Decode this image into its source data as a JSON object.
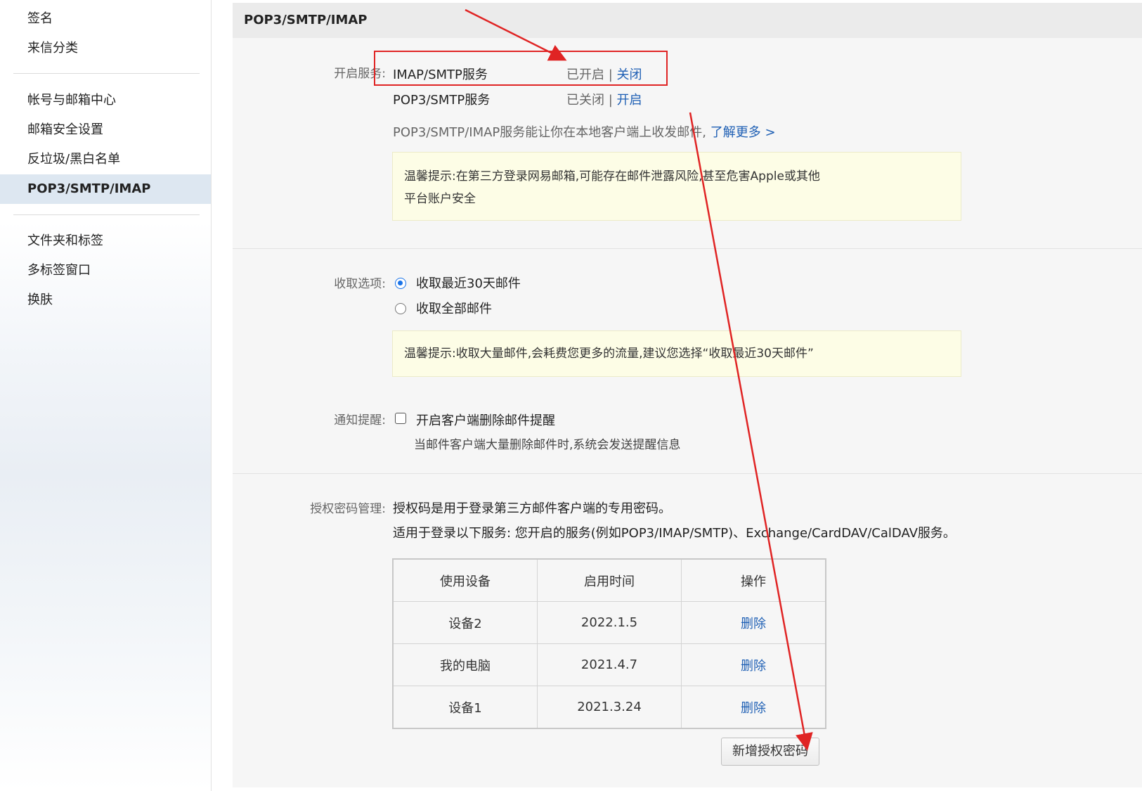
{
  "sidebar": {
    "items": [
      {
        "label": "签名"
      },
      {
        "label": "来信分类"
      },
      {
        "label": "帐号与邮箱中心"
      },
      {
        "label": "邮箱安全设置"
      },
      {
        "label": "反垃圾/黑白名单"
      },
      {
        "label": "POP3/SMTP/IMAP",
        "active": true
      },
      {
        "label": "文件夹和标签"
      },
      {
        "label": "多标签窗口"
      },
      {
        "label": "换肤"
      }
    ]
  },
  "panel": {
    "title": "POP3/SMTP/IMAP",
    "services": {
      "label": "开启服务:",
      "rows": [
        {
          "name": "IMAP/SMTP服务",
          "status": "已开启",
          "sep": "|",
          "action": "关闭"
        },
        {
          "name": "POP3/SMTP服务",
          "status": "已关闭",
          "sep": "|",
          "action": "开启"
        }
      ],
      "description": "POP3/SMTP/IMAP服务能让你在本地客户端上收发邮件,",
      "learn_more": "了解更多 >",
      "tip_line1": "温馨提示:在第三方登录网易邮箱,可能存在邮件泄露风险,甚至危害Apple或其他",
      "tip_line2": "平台账户安全"
    },
    "fetch": {
      "label": "收取选项:",
      "options": [
        {
          "label": "收取最近30天邮件",
          "selected": true
        },
        {
          "label": "收取全部邮件",
          "selected": false
        }
      ],
      "tip": "温馨提示:收取大量邮件,会耗费您更多的流量,建议您选择“收取最近30天邮件”"
    },
    "notify": {
      "label": "通知提醒:",
      "checkbox_label": "开启客户端删除邮件提醒",
      "checked": false,
      "hint": "当邮件客户端大量删除邮件时,系统会发送提醒信息"
    },
    "auth": {
      "label": "授权密码管理:",
      "line1": "授权码是用于登录第三方邮件客户端的专用密码。",
      "line2": "适用于登录以下服务: 您开启的服务(例如POP3/IMAP/SMTP)、Exchange/CardDAV/CalDAV服务。",
      "columns": [
        "使用设备",
        "启用时间",
        "操作"
      ],
      "rows": [
        {
          "device": "设备2",
          "time": "2022.1.5",
          "action": "删除"
        },
        {
          "device": "我的电脑",
          "time": "2021.4.7",
          "action": "删除"
        },
        {
          "device": "设备1",
          "time": "2021.3.24",
          "action": "删除"
        }
      ],
      "add_button": "新增授权密码"
    }
  },
  "colors": {
    "accent_link": "#1e5fb4",
    "annotation_red": "#e02424",
    "radio_blue": "#1a73e8"
  }
}
